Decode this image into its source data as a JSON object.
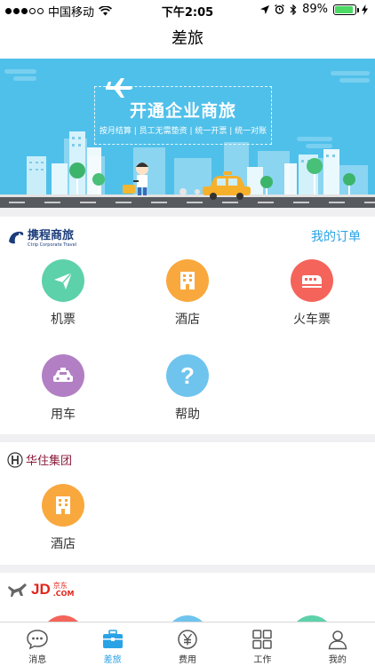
{
  "status_bar": {
    "carrier": "中国移动",
    "time": "下午2:05",
    "battery": "89%",
    "battery_level": 0.89
  },
  "nav": {
    "title": "差旅"
  },
  "banner": {
    "title": "开通企业商旅",
    "subtitle": "按月结算 | 员工无需垫资 | 统一开票 | 统一对账"
  },
  "ctrip": {
    "brand": "携程商旅",
    "brand_sub": "Ctrip Corporate Travel",
    "orders_link": "我的订单",
    "items": [
      {
        "label": "机票",
        "icon": "plane-icon",
        "color": "#5dd1a9"
      },
      {
        "label": "酒店",
        "icon": "hotel-icon",
        "color": "#f9a83d"
      },
      {
        "label": "火车票",
        "icon": "train-icon",
        "color": "#f4645b"
      },
      {
        "label": "用车",
        "icon": "car-icon",
        "color": "#b27fc4"
      },
      {
        "label": "帮助",
        "icon": "help-icon",
        "color": "#6fc4ee"
      }
    ]
  },
  "huazhu": {
    "brand": "华住集团",
    "items": [
      {
        "label": "酒店",
        "icon": "hotel-icon",
        "color": "#f9a83d"
      }
    ]
  },
  "jd": {
    "brand": "JD",
    "brand_cn": "京东",
    "brand_suffix": ".COM"
  },
  "tabbar": {
    "items": [
      {
        "label": "消息",
        "icon": "message-icon"
      },
      {
        "label": "差旅",
        "icon": "briefcase-icon",
        "active": true
      },
      {
        "label": "费用",
        "icon": "yen-icon"
      },
      {
        "label": "工作",
        "icon": "grid-icon"
      },
      {
        "label": "我的",
        "icon": "user-icon"
      }
    ],
    "active_color": "#2aa3e6",
    "inactive_color": "#555555"
  },
  "accent_color": "#2aa3e6"
}
